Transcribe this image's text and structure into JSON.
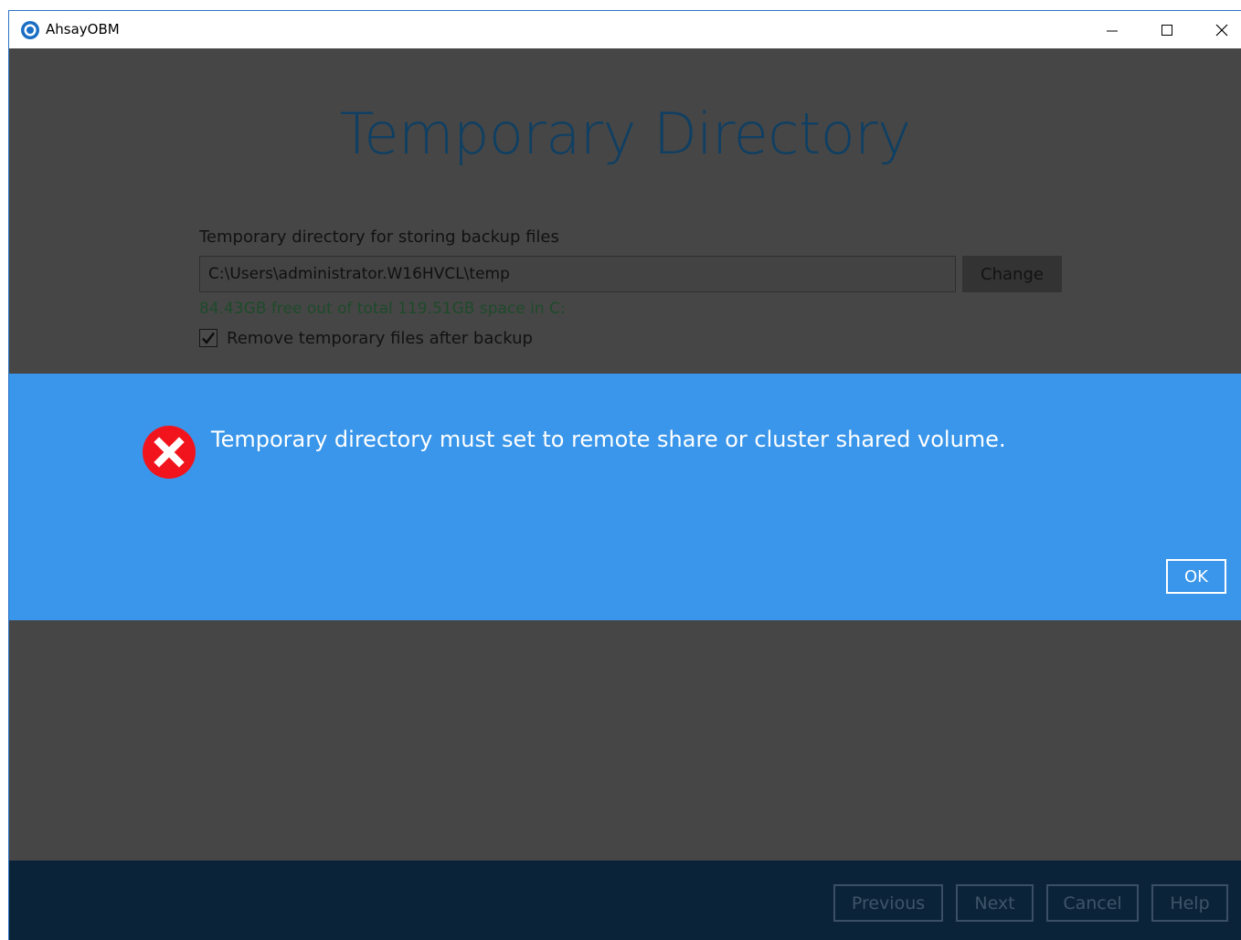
{
  "window": {
    "title": "AhsayOBM",
    "minimize_glyph": "—",
    "maximize_glyph": "☐",
    "close_glyph": "✕"
  },
  "page": {
    "title": "Temporary Directory",
    "field_label": "Temporary directory for storing backup files",
    "path_value": "C:\\Users\\administrator.W16HVCL\\temp",
    "change_label": "Change",
    "space_info": "84.43GB free out of total 119.51GB space in C:",
    "checkbox_label": "Remove temporary files after backup",
    "checkbox_checked": true
  },
  "dialog": {
    "message": "Temporary directory must set to remote share or cluster shared volume.",
    "ok_label": "OK",
    "icon": "error-x-icon"
  },
  "footer": {
    "previous_label": "Previous",
    "next_label": "Next",
    "cancel_label": "Cancel",
    "help_label": "Help"
  },
  "colors": {
    "dialog_bg": "#3a96ea",
    "footer_bg": "#0b2339",
    "overlay_bg": "#464646",
    "error_red": "#f2141d",
    "title_blue": "#0f3f62"
  }
}
